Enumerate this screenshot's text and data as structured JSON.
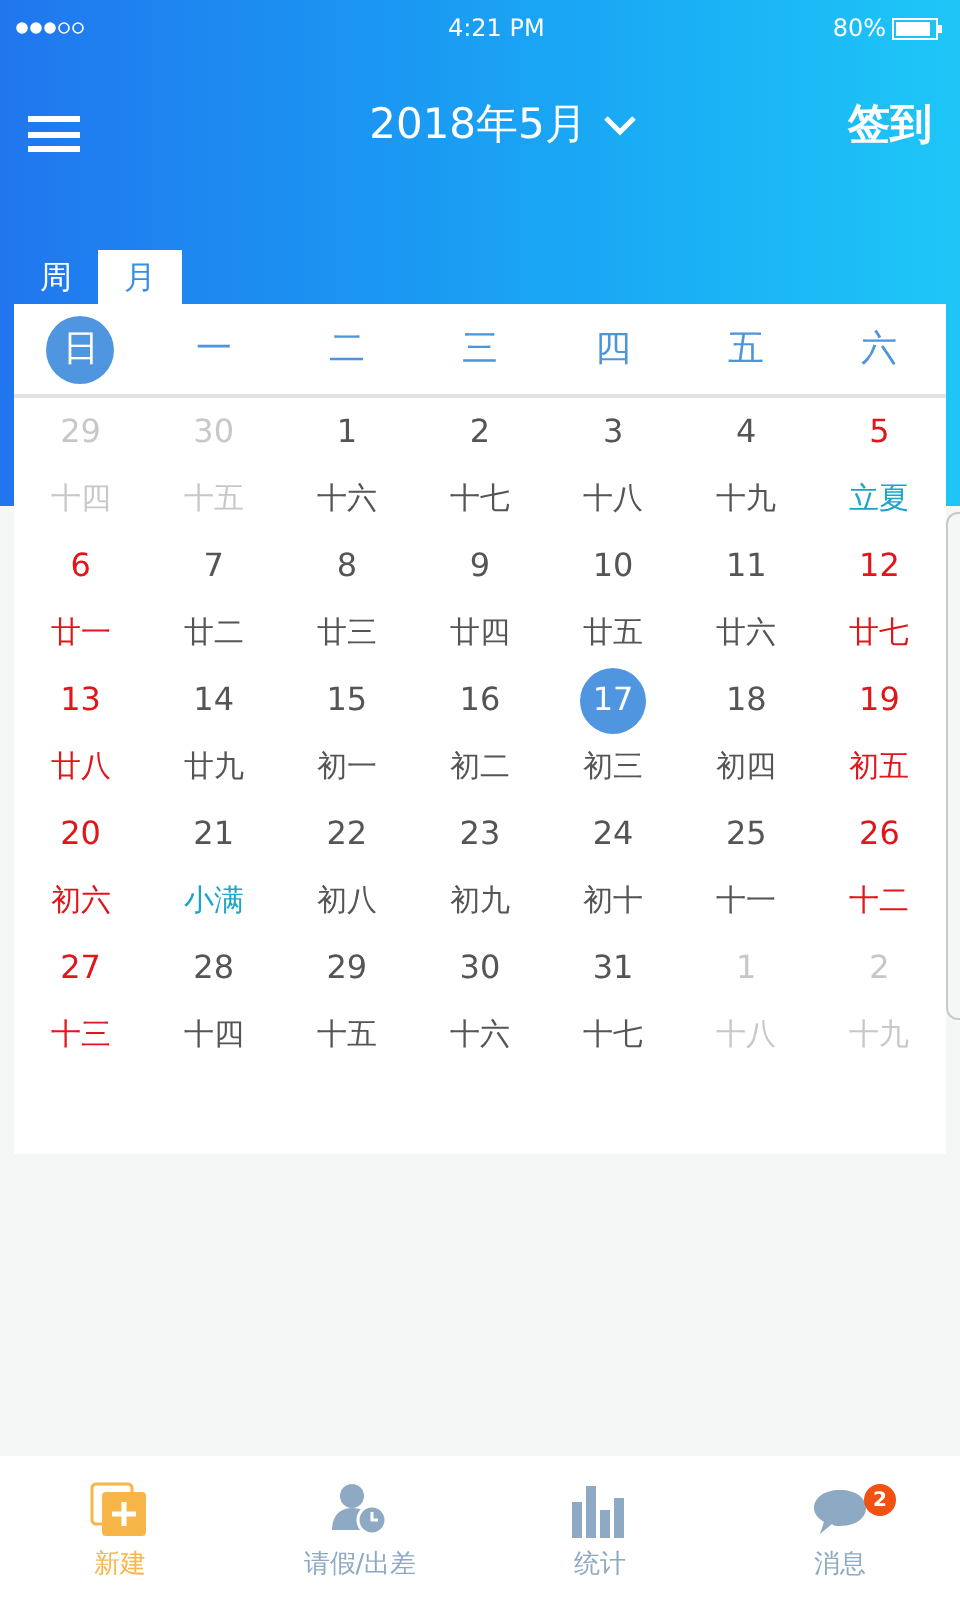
{
  "status_bar": {
    "time": "4:21 PM",
    "battery": "80%"
  },
  "header": {
    "title": "2018年5月",
    "action": "签到"
  },
  "tabs": [
    {
      "label": "周",
      "selected": false
    },
    {
      "label": "月",
      "selected": true
    }
  ],
  "weekdays": [
    {
      "label": "日",
      "selected": true
    },
    {
      "label": "一",
      "selected": false
    },
    {
      "label": "二",
      "selected": false
    },
    {
      "label": "三",
      "selected": false
    },
    {
      "label": "四",
      "selected": false
    },
    {
      "label": "五",
      "selected": false
    },
    {
      "label": "六",
      "selected": false
    }
  ],
  "weeks": [
    [
      {
        "date": "29",
        "lunar": "十四",
        "kind": "outside",
        "festival": false,
        "selected": false
      },
      {
        "date": "30",
        "lunar": "十五",
        "kind": "outside",
        "festival": false,
        "selected": false
      },
      {
        "date": "1",
        "lunar": "十六",
        "kind": "weekday",
        "festival": false,
        "selected": false
      },
      {
        "date": "2",
        "lunar": "十七",
        "kind": "weekday",
        "festival": false,
        "selected": false
      },
      {
        "date": "3",
        "lunar": "十八",
        "kind": "weekday",
        "festival": false,
        "selected": false
      },
      {
        "date": "4",
        "lunar": "十九",
        "kind": "weekday",
        "festival": false,
        "selected": false
      },
      {
        "date": "5",
        "lunar": "立夏",
        "kind": "weekend",
        "festival": true,
        "selected": false
      }
    ],
    [
      {
        "date": "6",
        "lunar": "廿一",
        "kind": "weekend",
        "festival": false,
        "selected": false
      },
      {
        "date": "7",
        "lunar": "廿二",
        "kind": "weekday",
        "festival": false,
        "selected": false
      },
      {
        "date": "8",
        "lunar": "廿三",
        "kind": "weekday",
        "festival": false,
        "selected": false
      },
      {
        "date": "9",
        "lunar": "廿四",
        "kind": "weekday",
        "festival": false,
        "selected": false
      },
      {
        "date": "10",
        "lunar": "廿五",
        "kind": "weekday",
        "festival": false,
        "selected": false
      },
      {
        "date": "11",
        "lunar": "廿六",
        "kind": "weekday",
        "festival": false,
        "selected": false
      },
      {
        "date": "12",
        "lunar": "廿七",
        "kind": "weekend",
        "festival": false,
        "selected": false
      }
    ],
    [
      {
        "date": "13",
        "lunar": "廿八",
        "kind": "weekend",
        "festival": false,
        "selected": false
      },
      {
        "date": "14",
        "lunar": "廿九",
        "kind": "weekday",
        "festival": false,
        "selected": false
      },
      {
        "date": "15",
        "lunar": "初一",
        "kind": "weekday",
        "festival": false,
        "selected": false
      },
      {
        "date": "16",
        "lunar": "初二",
        "kind": "weekday",
        "festival": false,
        "selected": false
      },
      {
        "date": "17",
        "lunar": "初三",
        "kind": "weekday",
        "festival": false,
        "selected": true
      },
      {
        "date": "18",
        "lunar": "初四",
        "kind": "weekday",
        "festival": false,
        "selected": false
      },
      {
        "date": "19",
        "lunar": "初五",
        "kind": "weekend",
        "festival": false,
        "selected": false
      }
    ],
    [
      {
        "date": "20",
        "lunar": "初六",
        "kind": "weekend",
        "festival": false,
        "selected": false
      },
      {
        "date": "21",
        "lunar": "小满",
        "kind": "weekday",
        "festival": true,
        "selected": false
      },
      {
        "date": "22",
        "lunar": "初八",
        "kind": "weekday",
        "festival": false,
        "selected": false
      },
      {
        "date": "23",
        "lunar": "初九",
        "kind": "weekday",
        "festival": false,
        "selected": false
      },
      {
        "date": "24",
        "lunar": "初十",
        "kind": "weekday",
        "festival": false,
        "selected": false
      },
      {
        "date": "25",
        "lunar": "十一",
        "kind": "weekday",
        "festival": false,
        "selected": false
      },
      {
        "date": "26",
        "lunar": "十二",
        "kind": "weekend",
        "festival": false,
        "selected": false
      }
    ],
    [
      {
        "date": "27",
        "lunar": "十三",
        "kind": "weekend",
        "festival": false,
        "selected": false
      },
      {
        "date": "28",
        "lunar": "十四",
        "kind": "weekday",
        "festival": false,
        "selected": false
      },
      {
        "date": "29",
        "lunar": "十五",
        "kind": "weekday",
        "festival": false,
        "selected": false
      },
      {
        "date": "30",
        "lunar": "十六",
        "kind": "weekday",
        "festival": false,
        "selected": false
      },
      {
        "date": "31",
        "lunar": "十七",
        "kind": "weekday",
        "festival": false,
        "selected": false
      },
      {
        "date": "1",
        "lunar": "十八",
        "kind": "outside",
        "festival": false,
        "selected": false
      },
      {
        "date": "2",
        "lunar": "十九",
        "kind": "outside",
        "festival": false,
        "selected": false
      }
    ]
  ],
  "nav": [
    {
      "label": "新建",
      "kind": "new",
      "selected": true
    },
    {
      "label": "请假/出差",
      "kind": "leave",
      "selected": false
    },
    {
      "label": "统计",
      "kind": "stats",
      "selected": false
    },
    {
      "label": "消息",
      "kind": "message",
      "selected": false,
      "badge": "2"
    }
  ]
}
